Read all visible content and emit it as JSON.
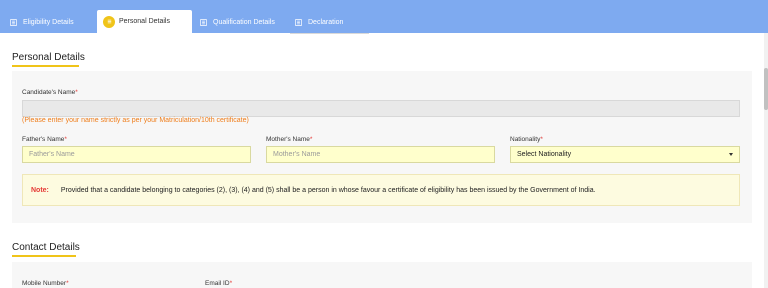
{
  "tabs": [
    {
      "label": "Eligibility Details",
      "icon": "list-icon",
      "active": false
    },
    {
      "label": "Personal Details",
      "icon": "list-icon",
      "active": true
    },
    {
      "label": "Qualification Details",
      "icon": "list-icon",
      "active": false
    },
    {
      "label": "Declaration",
      "icon": "list-icon",
      "active": false
    }
  ],
  "personal": {
    "title": "Personal Details",
    "candidate_name_label": "Candidate's Name",
    "candidate_name_value": "",
    "candidate_name_hint": "(Please enter your name strictly as per your Matriculation/10th certificate)",
    "father_label": "Father's Name",
    "father_placeholder": "Father's Name",
    "mother_label": "Mother's Name",
    "mother_placeholder": "Mother's Name",
    "nationality_label": "Nationality",
    "nationality_value": "Select Nationality",
    "note_label": "Note:",
    "note_text": "Provided that a candidate belonging to categories (2), (3), (4) and (5) shall be a person in whose favour a certificate of eligibility has been issued by the Government of India."
  },
  "contact": {
    "title": "Contact Details",
    "mobile_label": "Mobile Number",
    "email_label": "Email ID"
  },
  "required_mark": "*",
  "colors": {
    "tabbar": "#7eaaf0",
    "accent": "#f0c419",
    "input_bg": "#ffffcc",
    "hint": "#ef7d1a",
    "required": "#e53935"
  }
}
